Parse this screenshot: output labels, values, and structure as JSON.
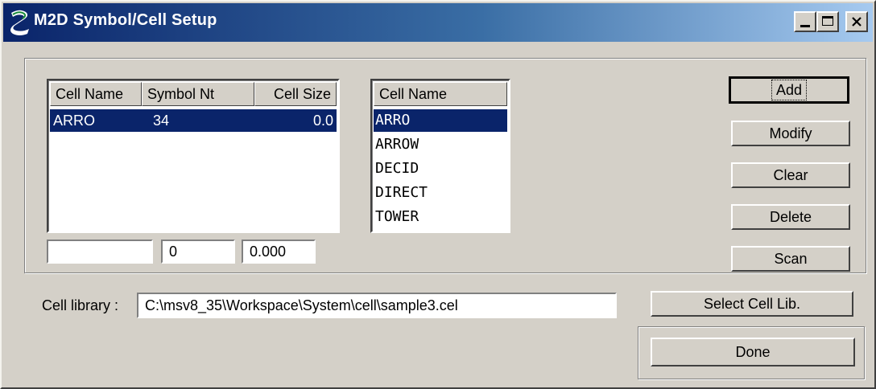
{
  "window": {
    "title": "M2D Symbol/Cell Setup",
    "controls": [
      "minimize",
      "maximize",
      "close"
    ]
  },
  "symbol_table": {
    "columns": [
      "Cell Name",
      "Symbol Nt",
      "Cell Size"
    ],
    "rows": [
      {
        "cell_name": "ARRO",
        "symbol": "34",
        "size": "0.0",
        "selected": true
      }
    ]
  },
  "edit_fields": {
    "cell_name": "",
    "symbol": "0",
    "size": "0.000"
  },
  "cell_list": {
    "header": "Cell Name",
    "items": [
      "ARRO",
      "ARROW",
      "DECID",
      "DIRECT",
      "TOWER"
    ],
    "selected_index": 0
  },
  "buttons": {
    "add": "Add",
    "modify": "Modify",
    "clear": "Clear",
    "delete": "Delete",
    "scan": "Scan",
    "select_cell_lib": "Select Cell Lib.",
    "done": "Done"
  },
  "cell_library": {
    "label": "Cell library :",
    "value": "C:\\msv8_35\\Workspace\\System\\cell\\sample3.cel"
  },
  "colors": {
    "face": "#d4d0c8",
    "selection": "#0a246a",
    "title_start": "#0a246a",
    "title_end": "#a6caf0"
  }
}
